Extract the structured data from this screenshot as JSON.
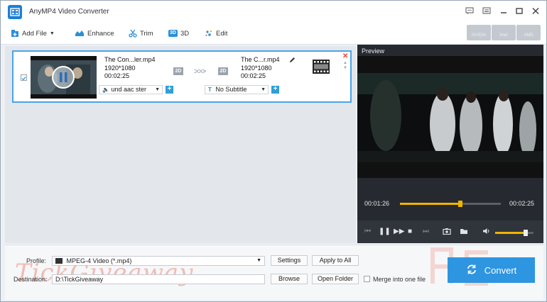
{
  "app": {
    "title": "AnyMP4 Video Converter"
  },
  "toolbar": {
    "add_file": "Add File",
    "enhance": "Enhance",
    "trim": "Trim",
    "three_d_badge": "3D",
    "three_d": "3D",
    "edit": "Edit",
    "hw": [
      "NVIDIA",
      "Intel",
      "AMD"
    ]
  },
  "file": {
    "source_name": "The Con...ler.mp4",
    "source_resolution": "1920*1080",
    "source_duration": "00:02:25",
    "source_mode": "2D",
    "target_name": "The C...r.mp4",
    "target_resolution": "1920*1080",
    "target_duration": "00:02:25",
    "target_mode": "2D",
    "arrows": ">>>",
    "audio_track": "und aac ster",
    "subtitle": "No Subtitle"
  },
  "preview": {
    "label": "Preview",
    "current_time": "00:01:26",
    "total_time": "00:02:25",
    "progress": 0.6,
    "volume": 0.8
  },
  "output": {
    "profile_label": "Profile:",
    "profile_value": "MPEG-4 Video (*.mp4)",
    "settings": "Settings",
    "apply_to_all": "Apply to All",
    "destination_label": "Destination:",
    "destination_value": "D:\\TickGiveaway",
    "browse": "Browse",
    "open_folder": "Open Folder",
    "merge_label": "Merge into one file",
    "convert": "Convert"
  },
  "watermark": {
    "text": "TickGiveaway"
  },
  "colors": {
    "accent": "#2e95e0",
    "progress": "#f0b400",
    "selection": "#4aa4e8"
  }
}
